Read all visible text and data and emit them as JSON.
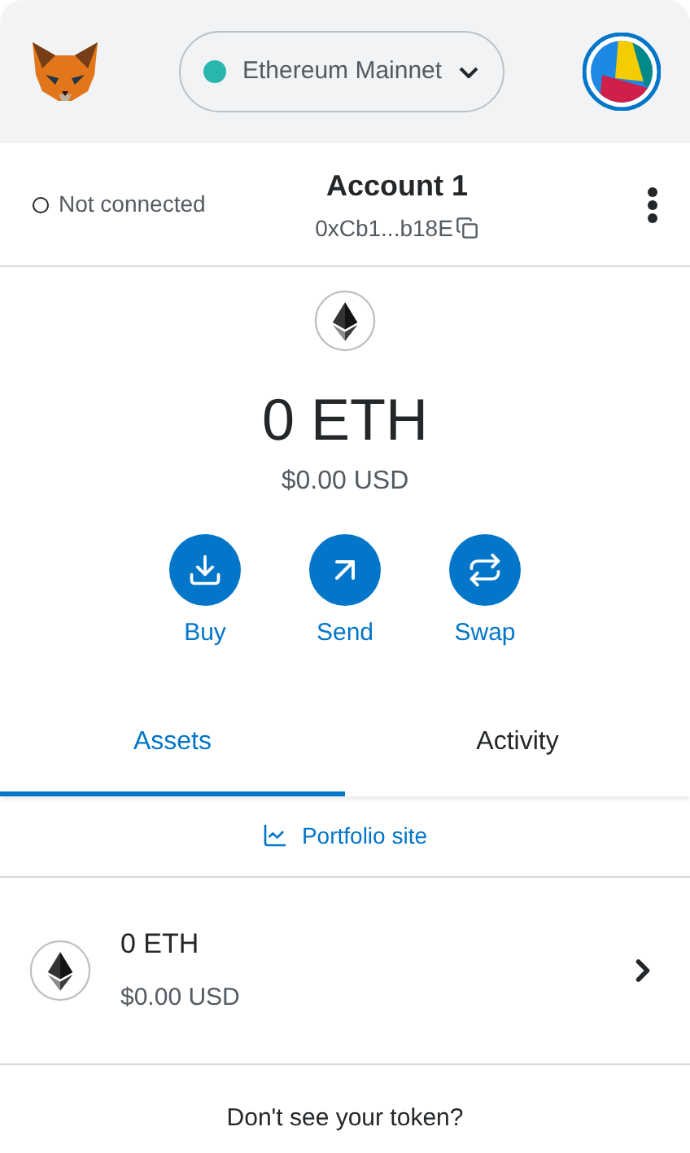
{
  "header": {
    "network": {
      "name": "Ethereum Mainnet",
      "color": "#29b6af"
    }
  },
  "account": {
    "connection": "Not connected",
    "name": "Account 1",
    "address": "0xCb1...b18E"
  },
  "balance": {
    "amount": "0 ETH",
    "fiat": "$0.00 USD"
  },
  "actions": [
    {
      "kind": "buy",
      "label": "Buy"
    },
    {
      "kind": "send",
      "label": "Send"
    },
    {
      "kind": "swap",
      "label": "Swap"
    }
  ],
  "tabs": [
    {
      "label": "Assets",
      "selected": true
    },
    {
      "label": "Activity",
      "selected": false
    }
  ],
  "portfolio_link": "Portfolio site",
  "assets": [
    {
      "amount": "0 ETH",
      "fiat": "$0.00 USD"
    }
  ],
  "footer_text": "Don't see your token?"
}
